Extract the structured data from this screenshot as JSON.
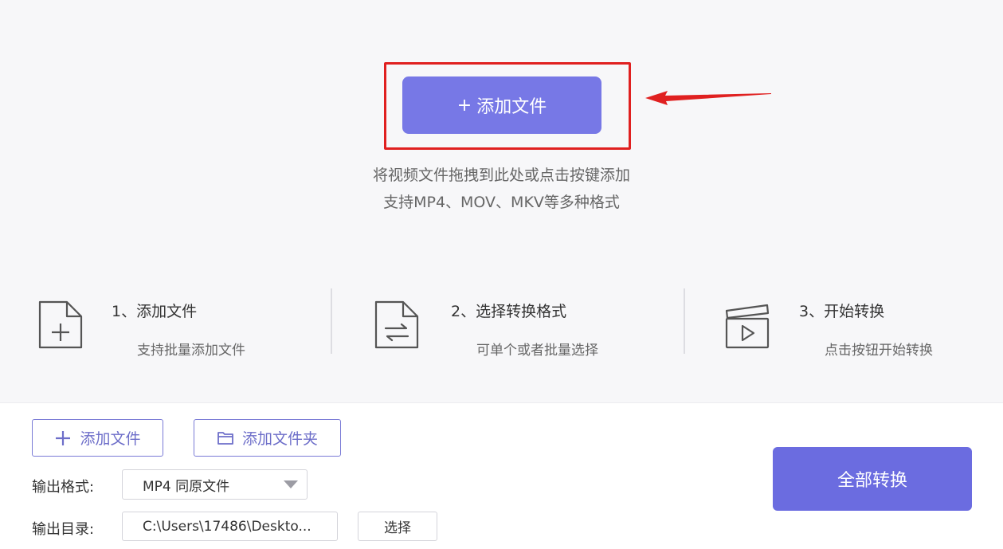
{
  "upload": {
    "plus": "+",
    "add_file_label": "添加文件",
    "hint_line1": "将视频文件拖拽到此处或点击按键添加",
    "hint_line2": "支持MP4、MOV、MKV等多种格式"
  },
  "steps": [
    {
      "title": "1、添加文件",
      "desc": "支持批量添加文件",
      "icon": "add-file-icon"
    },
    {
      "title": "2、选择转换格式",
      "desc": "可单个或者批量选择",
      "icon": "convert-file-icon"
    },
    {
      "title": "3、开始转换",
      "desc": "点击按钮开始转换",
      "icon": "clapper-play-icon"
    }
  ],
  "toolbar": {
    "add_file_label": "添加文件",
    "add_folder_label": "添加文件夹"
  },
  "output": {
    "format_label": "输出格式:",
    "format_value": "MP4 同原文件",
    "dir_label": "输出目录:",
    "dir_value": "C:\\Users\\17486\\Deskto...",
    "choose_label": "选择"
  },
  "convert_all_label": "全部转换",
  "colors": {
    "accent": "#7778e6",
    "highlight": "#e02020",
    "outline": "#7a7bd6"
  }
}
